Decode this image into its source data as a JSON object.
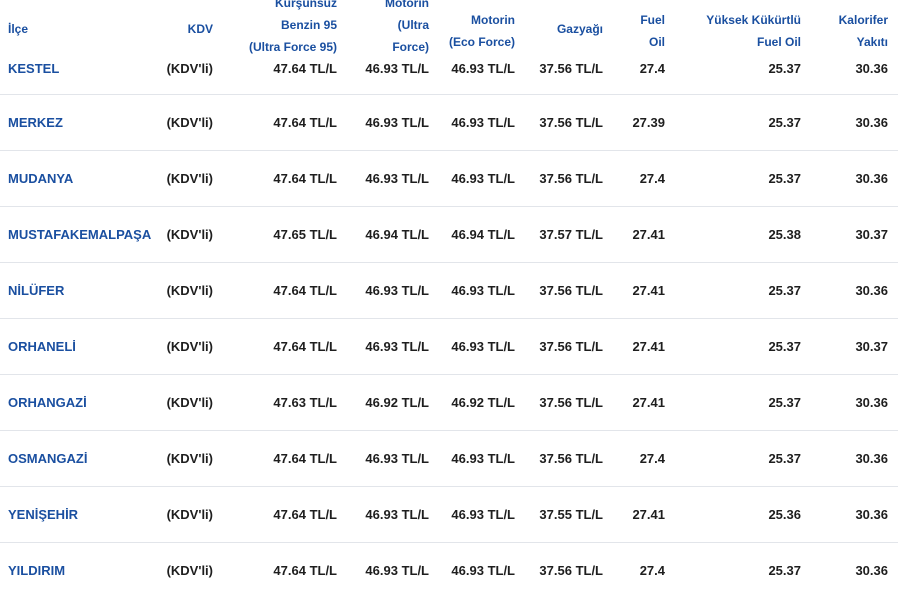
{
  "table": {
    "headers": {
      "district": "İlçe",
      "kdv": "KDV",
      "benzin_line1": "Kurşunsuz",
      "benzin_line2": "Benzin 95",
      "benzin_line3": "(Ultra Force 95)",
      "motorin_ultra_line1": "Motorin",
      "motorin_ultra_line2": "(Ultra",
      "motorin_ultra_line3": "Force)",
      "motorin_eco_line1": "Motorin",
      "motorin_eco_line2": "(Eco Force)",
      "gazyagi": "Gazyağı",
      "fuel_oil_line1": "Fuel",
      "fuel_oil_line2": "Oil",
      "high_sulfur_line1": "Yüksek Kükürtlü",
      "high_sulfur_line2": "Fuel Oil",
      "heating_line1": "Kalorifer",
      "heating_line2": "Yakıtı"
    },
    "rows": [
      {
        "district": "KESTEL",
        "kdv": "(KDV'li)",
        "benzin": "47.64 TL/L",
        "motorin_ultra": "46.93 TL/L",
        "motorin_eco": "46.93 TL/L",
        "gazyagi": "37.56 TL/L",
        "fuel_oil": "27.4",
        "high_sulfur": "25.37",
        "heating": "30.36"
      },
      {
        "district": "MERKEZ",
        "kdv": "(KDV'li)",
        "benzin": "47.64 TL/L",
        "motorin_ultra": "46.93 TL/L",
        "motorin_eco": "46.93 TL/L",
        "gazyagi": "37.56 TL/L",
        "fuel_oil": "27.39",
        "high_sulfur": "25.37",
        "heating": "30.36"
      },
      {
        "district": "MUDANYA",
        "kdv": "(KDV'li)",
        "benzin": "47.64 TL/L",
        "motorin_ultra": "46.93 TL/L",
        "motorin_eco": "46.93 TL/L",
        "gazyagi": "37.56 TL/L",
        "fuel_oil": "27.4",
        "high_sulfur": "25.37",
        "heating": "30.36"
      },
      {
        "district": "MUSTAFAKEMALPAŞA",
        "kdv": "(KDV'li)",
        "benzin": "47.65 TL/L",
        "motorin_ultra": "46.94 TL/L",
        "motorin_eco": "46.94 TL/L",
        "gazyagi": "37.57 TL/L",
        "fuel_oil": "27.41",
        "high_sulfur": "25.38",
        "heating": "30.37"
      },
      {
        "district": "NİLÜFER",
        "kdv": "(KDV'li)",
        "benzin": "47.64 TL/L",
        "motorin_ultra": "46.93 TL/L",
        "motorin_eco": "46.93 TL/L",
        "gazyagi": "37.56 TL/L",
        "fuel_oil": "27.41",
        "high_sulfur": "25.37",
        "heating": "30.36"
      },
      {
        "district": "ORHANELİ",
        "kdv": "(KDV'li)",
        "benzin": "47.64 TL/L",
        "motorin_ultra": "46.93 TL/L",
        "motorin_eco": "46.93 TL/L",
        "gazyagi": "37.56 TL/L",
        "fuel_oil": "27.41",
        "high_sulfur": "25.37",
        "heating": "30.37"
      },
      {
        "district": "ORHANGAZİ",
        "kdv": "(KDV'li)",
        "benzin": "47.63 TL/L",
        "motorin_ultra": "46.92 TL/L",
        "motorin_eco": "46.92 TL/L",
        "gazyagi": "37.56 TL/L",
        "fuel_oil": "27.41",
        "high_sulfur": "25.37",
        "heating": "30.36"
      },
      {
        "district": "OSMANGAZİ",
        "kdv": "(KDV'li)",
        "benzin": "47.64 TL/L",
        "motorin_ultra": "46.93 TL/L",
        "motorin_eco": "46.93 TL/L",
        "gazyagi": "37.56 TL/L",
        "fuel_oil": "27.4",
        "high_sulfur": "25.37",
        "heating": "30.36"
      },
      {
        "district": "YENİŞEHİR",
        "kdv": "(KDV'li)",
        "benzin": "47.64 TL/L",
        "motorin_ultra": "46.93 TL/L",
        "motorin_eco": "46.93 TL/L",
        "gazyagi": "37.55 TL/L",
        "fuel_oil": "27.41",
        "high_sulfur": "25.36",
        "heating": "30.36"
      },
      {
        "district": "YILDIRIM",
        "kdv": "(KDV'li)",
        "benzin": "47.64 TL/L",
        "motorin_ultra": "46.93 TL/L",
        "motorin_eco": "46.93 TL/L",
        "gazyagi": "37.56 TL/L",
        "fuel_oil": "27.4",
        "high_sulfur": "25.37",
        "heating": "30.36"
      }
    ]
  },
  "colors": {
    "header_text": "#1a4fa0",
    "district_text": "#1a4fa0",
    "cell_text": "#1e1e1e",
    "row_border": "#e2e5ea"
  }
}
